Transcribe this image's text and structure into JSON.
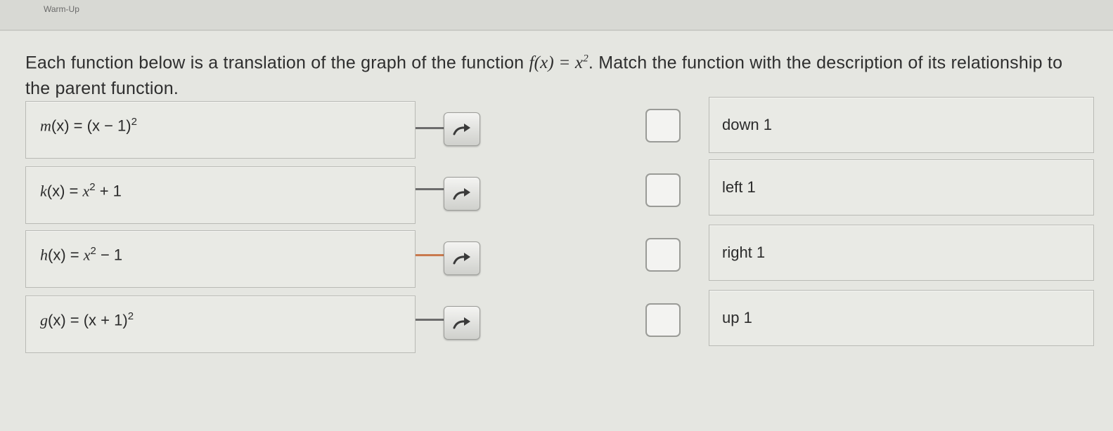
{
  "header": {
    "title": "Warm-Up"
  },
  "instructions": {
    "text_before": "Each function below is a translation of the graph of the function ",
    "parent_function_lhs": "f(x)",
    "parent_function_eq": " = ",
    "parent_function_base": "x",
    "parent_function_exp": "2",
    "text_after": ". Match the function with the description of its relationship to the parent function."
  },
  "functions": [
    {
      "name": "m",
      "arg": "(x)",
      "eq": " = ",
      "body": "(x − 1)",
      "exp": "2",
      "tail": ""
    },
    {
      "name": "k",
      "arg": "(x)",
      "eq": " = ",
      "body": "x",
      "exp": "2",
      "tail": " + 1"
    },
    {
      "name": "h",
      "arg": "(x)",
      "eq": " = ",
      "body": "x",
      "exp": "2",
      "tail": " − 1"
    },
    {
      "name": "g",
      "arg": "(x)",
      "eq": " = ",
      "body": "(x + 1)",
      "exp": "2",
      "tail": ""
    }
  ],
  "descriptions": [
    "down 1",
    "left 1",
    "right 1",
    "up 1"
  ],
  "icons": {
    "arrow": "curved-arrow-icon"
  },
  "colors": {
    "connector": "#6c6c6c",
    "connector_active": "#c97a4e"
  }
}
